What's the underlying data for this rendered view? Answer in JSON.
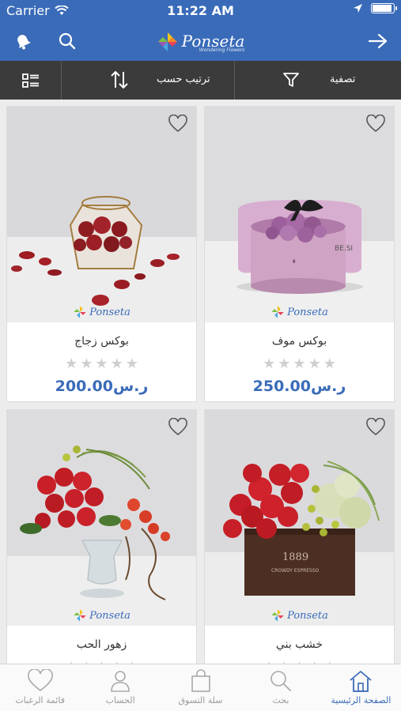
{
  "status_bar": {
    "carrier": "Carrier",
    "time": "11:22 AM",
    "battery_level": 0.95
  },
  "header": {
    "brand": "Ponseta",
    "brand_tagline": "Wondering Flowers"
  },
  "toolbar": {
    "filter_label": "تصفية",
    "sort_label": "ترتيب حسب"
  },
  "products": [
    {
      "name": "بوكس موف",
      "price": "250.00",
      "currency": "ر.س",
      "rating": 0,
      "max_rating": 5,
      "watermark": "Ponseta"
    },
    {
      "name": "بوكس زجاج",
      "price": "200.00",
      "currency": "ر.س",
      "rating": 0,
      "max_rating": 5,
      "watermark": "Ponseta"
    },
    {
      "name": "خشب بني",
      "price": "",
      "currency": "",
      "rating": 0,
      "max_rating": 5,
      "watermark": "Ponseta"
    },
    {
      "name": "زهور الحب",
      "price": "",
      "currency": "",
      "rating": 0,
      "max_rating": 5,
      "watermark": "Ponseta"
    }
  ],
  "tabs": [
    {
      "label": "الصفحة الرئيسية",
      "icon": "home-icon",
      "active": true
    },
    {
      "label": "بحث",
      "icon": "search-icon",
      "active": false
    },
    {
      "label": "سلة التسوق",
      "icon": "shopping-bag-icon",
      "active": false
    },
    {
      "label": "الحساب",
      "icon": "user-icon",
      "active": false
    },
    {
      "label": "قائمة الرغبات",
      "icon": "heart-icon",
      "active": false
    }
  ],
  "colors": {
    "primary": "#3a6bb9",
    "toolbar": "#3b3b3b",
    "star_inactive": "#cfcfcf"
  }
}
